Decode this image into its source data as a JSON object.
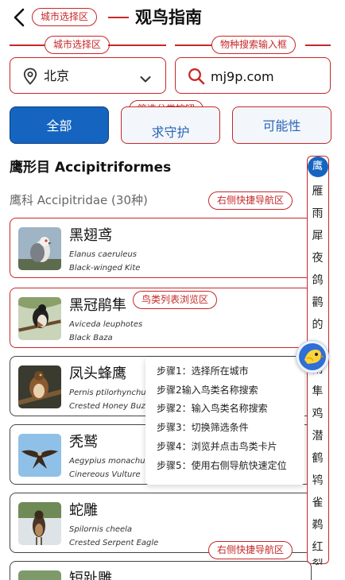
{
  "header": {
    "title": "观鸟指南",
    "back_icon": "back-arrow-icon"
  },
  "annotations": {
    "header_city": "城市选择区",
    "city_select": "城市选择区",
    "search": "物种搜索输入框",
    "filter": "筛选分类按钮",
    "quick_nav_top": "右侧快捷导航区",
    "bird_list": "鸟类列表浏览区",
    "quick_nav_bottom": "右侧快捷导航区"
  },
  "city": {
    "value": "北京",
    "icon": "location-pin-icon"
  },
  "search": {
    "value": "mj9p.com",
    "icon": "search-icon"
  },
  "filters": {
    "all": "全部",
    "protected": "求守护",
    "possible": "可能性"
  },
  "order_title": "鹰形目 Accipitriformes",
  "family_title": "鹰科 Accipitridae (30种)",
  "birds": [
    {
      "name": "黑翅鸢",
      "latin": "Elanus caeruleus",
      "english": "Black-winged Kite"
    },
    {
      "name": "黑冠鹃隼",
      "latin": "Aviceda leuphotes",
      "english": "Black Baza"
    },
    {
      "name": "凤头蜂鹰",
      "latin": "Pernis ptilorhynchus",
      "english": "Crested Honey Buzzard"
    },
    {
      "name": "秃鹫",
      "latin": "Aegypius monachus",
      "english": "Cinereous Vulture"
    },
    {
      "name": "蛇雕",
      "latin": "Spilornis cheela",
      "english": "Crested Serpent Eagle"
    },
    {
      "name": "短趾雕",
      "latin": "",
      "english": ""
    }
  ],
  "quick_nav": [
    "鹰",
    "雁",
    "雨",
    "犀",
    "夜",
    "鸽",
    "鹳",
    "的",
    "",
    "雨",
    "隼",
    "鸡",
    "潜",
    "鹤",
    "鸨",
    "雀",
    "鹈",
    "红",
    "裂"
  ],
  "steps": [
    "步骤1：选择所在城市",
    "步骤2输入鸟类名称搜索",
    "步骤2：输入鸟类名称搜索",
    "步骤3：切换筛选条件",
    "步骤4：浏览并点击鸟类卡片",
    "步骤5：使用右侧导航快速定位"
  ],
  "colors": {
    "primary": "#1565c0",
    "annotation": "#c62828",
    "filter_text": "#2a64b4"
  }
}
